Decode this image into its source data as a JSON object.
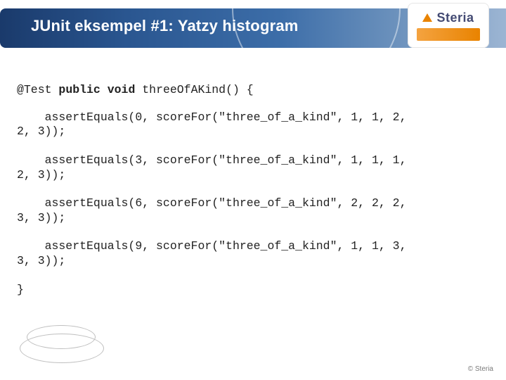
{
  "header": {
    "title": "JUnit eksempel #1: Yatzy histogram",
    "logo": {
      "brand": "Steria"
    }
  },
  "code": {
    "annotation": "@Test",
    "kw_public": "public",
    "kw_void": "void",
    "method_name": "threeOfAKind()",
    "brace_open": "{",
    "asserts": [
      {
        "line1": "    assertEquals(0, scoreFor(\"three_of_a_kind\", 1, 1, 2,",
        "line2": "2, 3));"
      },
      {
        "line1": "    assertEquals(3, scoreFor(\"three_of_a_kind\", 1, 1, 1,",
        "line2": "2, 3));"
      },
      {
        "line1": "    assertEquals(6, scoreFor(\"three_of_a_kind\", 2, 2, 2,",
        "line2": "3, 3));"
      },
      {
        "line1": "    assertEquals(9, scoreFor(\"three_of_a_kind\", 1, 1, 3,",
        "line2": "3, 3));"
      }
    ],
    "brace_close": "}"
  },
  "footer": {
    "copyright": "© Steria"
  }
}
